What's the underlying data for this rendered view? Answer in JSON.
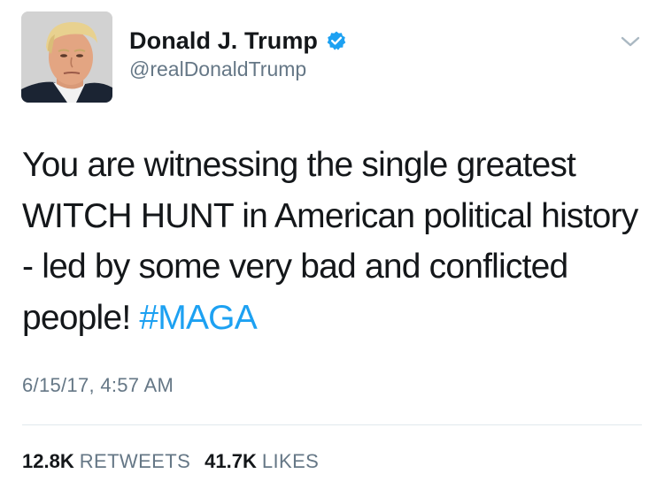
{
  "author": {
    "display_name": "Donald J. Trump",
    "handle": "@realDonaldTrump",
    "verified": true,
    "avatar_icon": "profile-photo"
  },
  "tweet": {
    "text": "You are witnessing the single greatest WITCH HUNT in American political history - led by some very bad and conflicted people! ",
    "hashtag": "#MAGA",
    "timestamp": "6/15/17, 4:57 AM"
  },
  "stats": {
    "retweets_count": "12.8K",
    "retweets_label": "RETWEETS",
    "likes_count": "41.7K",
    "likes_label": "LIKES"
  },
  "colors": {
    "hashtag": "#1da1f2",
    "verified_badge": "#1da1f2",
    "secondary_text": "#657786",
    "primary_text": "#14171a",
    "divider": "#e1e8ed"
  },
  "icons": {
    "verified": "verified-badge-icon",
    "menu": "chevron-down-icon"
  }
}
